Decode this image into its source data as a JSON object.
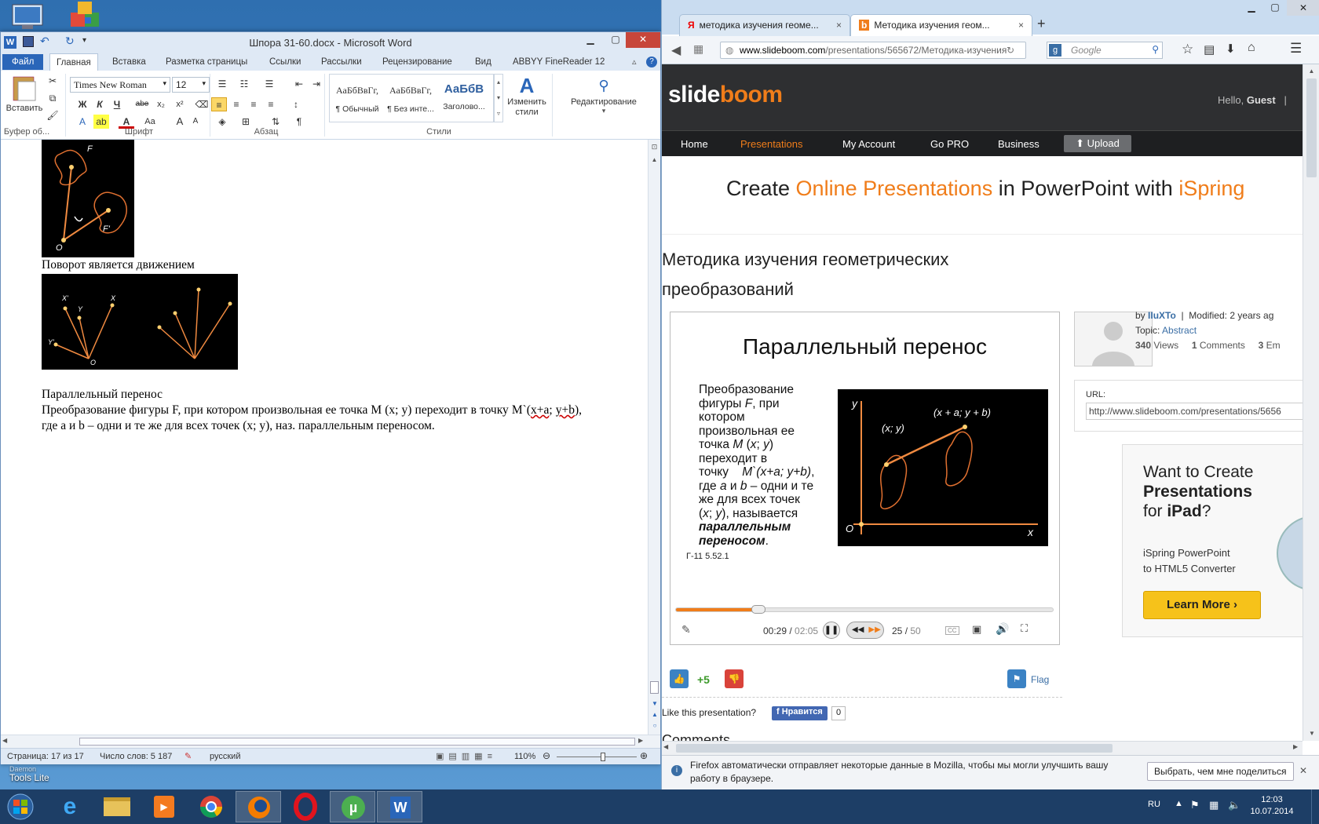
{
  "desktop": {
    "icon_label_line1": "Daemon",
    "icon_label_line2": "Tools Lite"
  },
  "word": {
    "title": "Шпора 31-60.docx - Microsoft Word",
    "tabs": [
      "Файл",
      "Главная",
      "Вставка",
      "Разметка страницы",
      "Ссылки",
      "Рассылки",
      "Рецензирование",
      "Вид",
      "ABBYY FineReader 12"
    ],
    "clipboard": {
      "paste_label": "Вставить",
      "group_label": "Буфер об..."
    },
    "font": {
      "name": "Times New Roman",
      "size": "12",
      "group_label": "Шрифт",
      "bold": "Ж",
      "italic": "К",
      "underline": "Ч",
      "strike": "abe",
      "sub": "x₂",
      "sup": "x²"
    },
    "paragraph": {
      "group_label": "Абзац"
    },
    "styles": {
      "items": [
        {
          "sample": "АаБбВвГг,",
          "name": "¶ Обычный"
        },
        {
          "sample": "АаБбВвГг,",
          "name": "¶ Без инте..."
        },
        {
          "sample": "АаБбВ",
          "name": "Заголово..."
        }
      ],
      "change_label": "Изменить стили",
      "group_label": "Стили"
    },
    "editing_label": "Редактирование",
    "doc": {
      "fig1_labels": {
        "f": "F",
        "f2": "F'",
        "o": "O"
      },
      "caption1": "Поворот является движением",
      "fig2_labels": {
        "x1": "X'",
        "y1": "Y",
        "x": "X",
        "y2": "Y'",
        "o": "O"
      },
      "heading": "Параллельный перенос",
      "para_part1": "Преобразование фигуры F, при котором произвольная ее точка М (x; y) переходит в точку   M`(",
      "para_link1": "x+a",
      "para_part2": "; ",
      "para_link2": "y+b",
      "para_part3": "), где a и b – одни и те же для всех точек (x; y), наз. параллельным переносом."
    },
    "status": {
      "page": "Страница: 17 из 17",
      "words": "Число слов: 5 187",
      "language": "русский",
      "zoom": "110%",
      "zoom_level": 0.58
    }
  },
  "firefox": {
    "tabs": [
      {
        "title": "методика изучения геоме...",
        "icon": "yandex-icon"
      },
      {
        "title": "Методика изучения геом...",
        "icon": "slideboom-icon"
      }
    ],
    "url_domain": "www.slideboom.com",
    "url_path": "/presentations/565672/Методика-изучения-",
    "search_placeholder": "Google",
    "notification": "Firefox автоматически отправляет некоторые данные в Mozilla, чтобы мы могли улучшить вашу работу в браузере.",
    "notification_button": "Выбрать, чем мне поделиться"
  },
  "slideboom": {
    "logo_part1": "slide",
    "logo_part2": "boom",
    "greeting": "Hello,",
    "greeting_user": "Guest",
    "nav": [
      "Home",
      "Presentations",
      "My Account",
      "Go PRO",
      "Business"
    ],
    "upload": "Upload",
    "banner": {
      "p1": "Create ",
      "p2": "Online Presentations",
      "p3": " in PowerPoint with ",
      "p4": "iSpring"
    },
    "title": "Методика изучения геометрических преобразований",
    "slide": {
      "title": "Параллельный перенос",
      "line1": "Преобразование",
      "line2": "фигуры ",
      "line2b": "F",
      "line2c": ", при",
      "line3": "котором",
      "line4": "произвольная ее",
      "line5a": "точка ",
      "line5b": "M",
      "line5c": " (",
      "line5d": "x",
      "line5e": "; ",
      "line5f": "y",
      "line5g": ")",
      "line6": "переходит в",
      "line7a": "точку    ",
      "line7b": "M`(x+a; y+b)",
      "line7c": ",",
      "line8a": "где ",
      "line8b": "a",
      "line8c": " и ",
      "line8d": "b",
      "line8e": " – одни и те",
      "line9": "же для всех точек",
      "line10a": "(",
      "line10b": "x",
      "line10c": "; ",
      "line10d": "y",
      "line10e": "), называется",
      "line11": "параллельным",
      "line12a": "переносом",
      "line12b": ".",
      "footer": "Г-11 5.52.1",
      "graph": {
        "y": "y",
        "x": "x",
        "o": "O",
        "p1": "(x; y)",
        "p2": "(x + a; y + b)"
      }
    },
    "player": {
      "time": "00:29",
      "duration": "02:05",
      "slide": "25",
      "slides": "50",
      "progress": 0.22,
      "cc": "CC"
    },
    "rating": "+5",
    "flag": "Flag",
    "like_q": "Like this presentation?",
    "fb_like": "Нравится",
    "fb_count": "0",
    "comments_heading": "Comments",
    "meta": {
      "by": "by",
      "author": "IIuXTo",
      "sep": "|",
      "modified_label": "Modified:",
      "modified": "2 years ag",
      "topic_label": "Topic:",
      "topic": "Abstract",
      "views_n": "340",
      "views": "Views",
      "comments_n": "1",
      "comments": "Comments",
      "embeds_n": "3",
      "embeds": "Em"
    },
    "url_label": "URL:",
    "url_value": "http://www.slideboom.com/presentations/5656",
    "ad": {
      "l1": "Want to Create",
      "l2": "Presentations",
      "l3a": "for ",
      "l3b": "iPad",
      "l3c": "?",
      "l4": "iSpring PowerPoint",
      "l5": "to HTML5 Converter",
      "button": "Learn More ›"
    }
  },
  "taskbar": {
    "lang": "RU",
    "time": "12:03",
    "date": "10.07.2014"
  },
  "colors": {
    "word_blue": "#2a66b9",
    "slideboom_orange": "#f07d1a",
    "ff_blue": "#3a6ea5",
    "taskbar": "#1d3e66"
  }
}
